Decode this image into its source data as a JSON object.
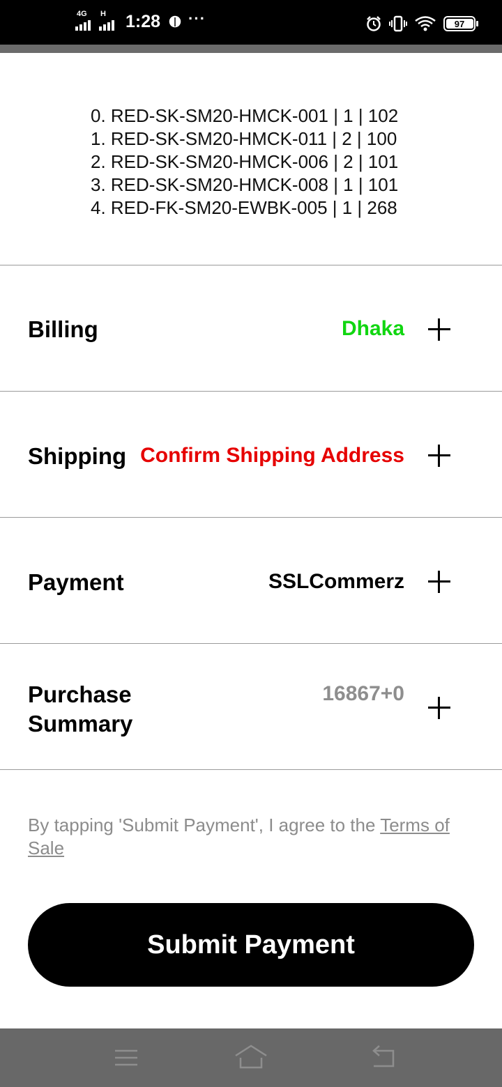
{
  "status_bar": {
    "network_1": "4G",
    "network_2": "H",
    "time": "1:28",
    "more": "···",
    "battery": "97"
  },
  "order": {
    "lines": [
      "0. RED-SK-SM20-HMCK-001 | 1 | 102",
      "1. RED-SK-SM20-HMCK-011 | 2 | 100",
      "2. RED-SK-SM20-HMCK-006 | 2 | 101",
      "3. RED-SK-SM20-HMCK-008 | 1 | 101",
      "4. RED-FK-SM20-EWBK-005 | 1 | 268"
    ]
  },
  "sections": {
    "billing": {
      "label": "Billing",
      "value": "Dhaka",
      "value_color": "#11d611"
    },
    "shipping": {
      "label": "Shipping",
      "value": "Confirm Shipping Address",
      "value_color": "#e60000"
    },
    "payment": {
      "label": "Payment",
      "value": "SSLCommerz",
      "value_color": "#000000"
    },
    "summary": {
      "label_line1": "Purchase",
      "label_line2": "Summary",
      "value": "16867+0",
      "value_color": "#8e8e8e"
    }
  },
  "terms": {
    "prefix": "By tapping 'Submit Payment', I agree to the ",
    "link": "Terms of Sale"
  },
  "submit_label": "Submit Payment",
  "nav_bar": {
    "icons": [
      "menu-icon",
      "home-icon",
      "back-icon"
    ]
  }
}
